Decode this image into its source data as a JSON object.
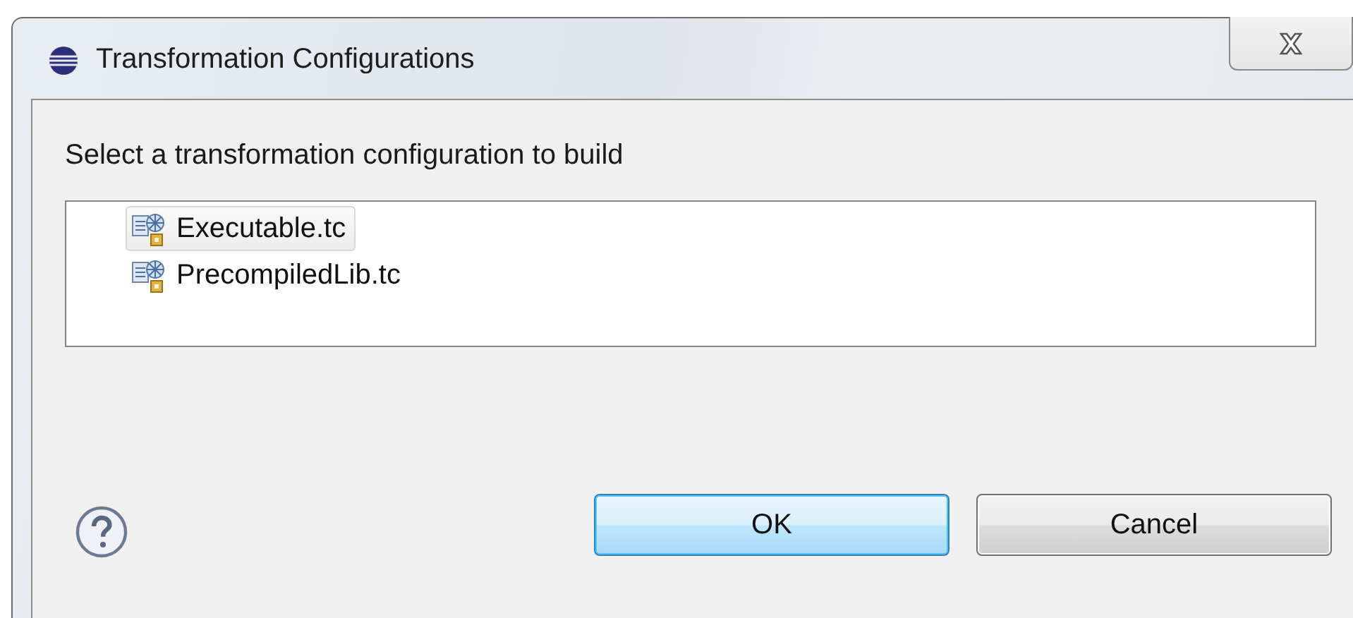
{
  "window": {
    "title": "Transformation Configurations"
  },
  "prompt": "Select a transformation configuration to build",
  "configurations": [
    {
      "label": "Executable.tc",
      "selected": true
    },
    {
      "label": "PrecompiledLib.tc",
      "selected": false
    }
  ],
  "buttons": [
    {
      "label": "OK",
      "kind": "default"
    },
    {
      "label": "Cancel",
      "kind": "normal"
    }
  ]
}
